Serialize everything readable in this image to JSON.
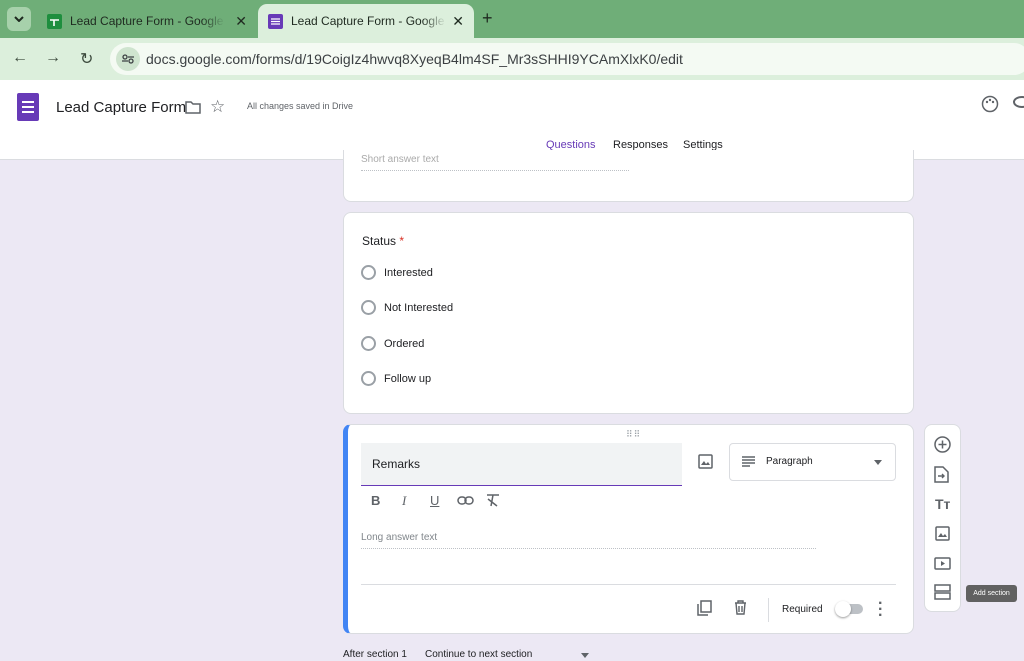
{
  "browser": {
    "tabs": [
      {
        "title": "Lead Capture Form - Google Sheets",
        "icon": "sheets-icon",
        "active": false
      },
      {
        "title": "Lead Capture Form - Google Forms",
        "icon": "forms-icon",
        "active": true
      }
    ],
    "url": "docs.google.com/forms/d/19CoigIz4hwvq8XyeqB4lm4SF_Mr3sSHHI9YCAmXlxK0/edit"
  },
  "header": {
    "title": "Lead Capture Form",
    "save_status": "All changes saved in Drive",
    "tabs": [
      "Questions",
      "Responses",
      "Settings"
    ],
    "active_tab": "Questions"
  },
  "prev_question": {
    "placeholder": "Short answer text"
  },
  "status_question": {
    "title": "Status",
    "required_mark": "*",
    "options": [
      "Interested",
      "Not Interested",
      "Ordered",
      "Follow up"
    ]
  },
  "remarks_question": {
    "title": "Remarks",
    "type": "Paragraph",
    "placeholder": "Long answer text",
    "format_buttons": [
      "B",
      "I",
      "U"
    ],
    "required_label": "Required",
    "required": false
  },
  "toolbar": {
    "tooltip": "Add section"
  },
  "section": {
    "after_label": "After section 1",
    "action": "Continue to next section"
  },
  "colors": {
    "accent": "#673ab7",
    "active_border": "#4285f4",
    "background": "#ece8f4"
  }
}
